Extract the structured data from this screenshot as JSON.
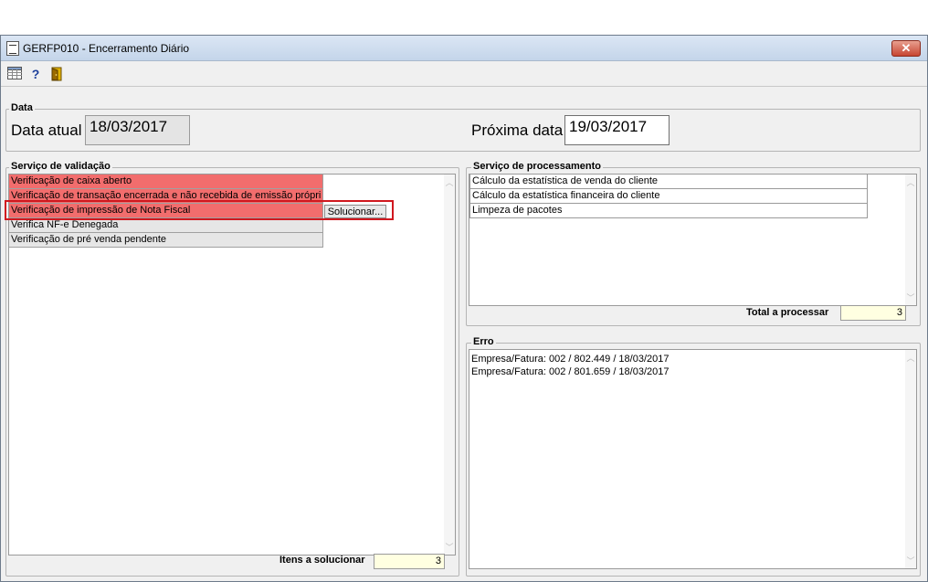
{
  "window": {
    "title": "GERFP010 - Encerramento Diário",
    "close_label": "✕"
  },
  "toolbar": {
    "grid_icon": "grid-icon",
    "help_icon": "help-icon",
    "exit_icon": "exit-door-icon",
    "help_glyph": "?"
  },
  "data_group": {
    "legend": "Data",
    "current_label": "Data atual",
    "current_value": "18/03/2017",
    "next_label": "Próxima data",
    "next_value": "19/03/2017"
  },
  "validation": {
    "legend": "Serviço de validação",
    "items": [
      {
        "label": "Verificação de caixa aberto",
        "status": "error"
      },
      {
        "label": "Verificação de transação encerrada e não recebida de emissão própri",
        "status": "error"
      },
      {
        "label": "Verificação de impressão de Nota Fiscal",
        "status": "error"
      },
      {
        "label": "Verifica NF-e Denegada",
        "status": "ok"
      },
      {
        "label": "Verificação de pré venda pendente",
        "status": "ok"
      }
    ],
    "solve_button": "Solucionar...",
    "items_to_solve_label": "Itens a solucionar",
    "items_to_solve_value": "3"
  },
  "processing": {
    "legend": "Serviço de processamento",
    "items": [
      "Cálculo da estatística de venda do cliente",
      "Cálculo da estatística financeira do cliente",
      "Limpeza de pacotes"
    ],
    "total_label": "Total a processar",
    "total_value": "3"
  },
  "error": {
    "legend": "Erro",
    "lines": [
      "Empresa/Fatura: 002 / 802.449 / 18/03/2017",
      "Empresa/Fatura: 002 / 801.659 / 18/03/2017"
    ]
  },
  "colors": {
    "error_row": "#f26d6d",
    "highlight_border": "#d0181f",
    "field_bg": "#ffffe1"
  }
}
